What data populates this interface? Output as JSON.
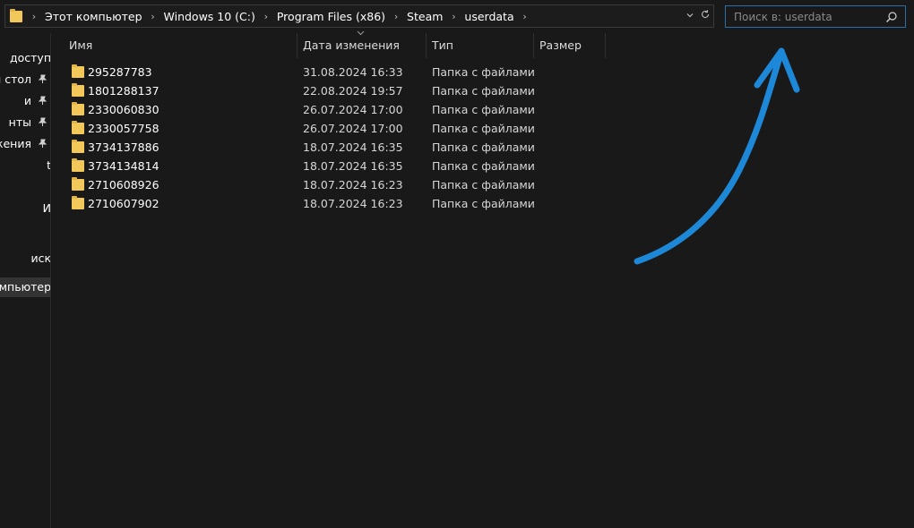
{
  "address": {
    "crumbs": [
      "Этот компьютер",
      "Windows 10 (C:)",
      "Program Files (x86)",
      "Steam",
      "userdata"
    ]
  },
  "search": {
    "placeholder": "Поиск в: userdata"
  },
  "sidebar": {
    "items": [
      {
        "label": "доступ",
        "pinned": false,
        "selected": false
      },
      {
        "label": "й стол",
        "pinned": true,
        "selected": false
      },
      {
        "label": "и",
        "pinned": true,
        "selected": false
      },
      {
        "label": "нты",
        "pinned": true,
        "selected": false
      },
      {
        "label": "жения",
        "pinned": true,
        "selected": false
      },
      {
        "label": "t",
        "pinned": false,
        "selected": false
      },
      {
        "label": "И",
        "pinned": false,
        "selected": false
      },
      {
        "label": "иск",
        "pinned": false,
        "selected": false
      },
      {
        "label": "омпьютер",
        "pinned": false,
        "selected": true
      }
    ]
  },
  "columns": {
    "name": "Имя",
    "date": "Дата изменения",
    "type": "Тип",
    "size": "Размер"
  },
  "files": [
    {
      "name": "295287783",
      "date": "31.08.2024 16:33",
      "type": "Папка с файлами",
      "size": ""
    },
    {
      "name": "1801288137",
      "date": "22.08.2024 19:57",
      "type": "Папка с файлами",
      "size": ""
    },
    {
      "name": "2330060830",
      "date": "26.07.2024 17:00",
      "type": "Папка с файлами",
      "size": ""
    },
    {
      "name": "2330057758",
      "date": "26.07.2024 17:00",
      "type": "Папка с файлами",
      "size": ""
    },
    {
      "name": "3734137886",
      "date": "18.07.2024 16:35",
      "type": "Папка с файлами",
      "size": ""
    },
    {
      "name": "3734134814",
      "date": "18.07.2024 16:35",
      "type": "Папка с файлами",
      "size": ""
    },
    {
      "name": "2710608926",
      "date": "18.07.2024 16:23",
      "type": "Папка с файлами",
      "size": ""
    },
    {
      "name": "2710607902",
      "date": "18.07.2024 16:23",
      "type": "Папка с файлами",
      "size": ""
    }
  ],
  "colors": {
    "background": "#191919",
    "folder": "#f2c85a",
    "search_border": "#2b6ea8",
    "annotation_arrow": "#1e88d8"
  }
}
